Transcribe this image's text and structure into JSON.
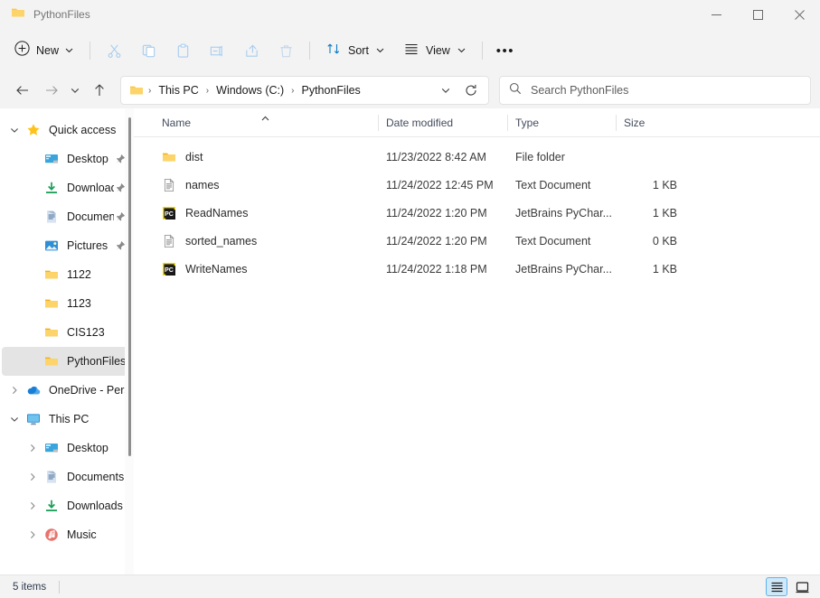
{
  "window": {
    "title": "PythonFiles",
    "title_icon": "folder-icon",
    "controls": {
      "minimize": "Minimize",
      "maximize": "Maximize",
      "close": "Close"
    }
  },
  "toolbar": {
    "new_label": "New",
    "new_icon": "plus-circle-icon",
    "chevron_icon": "chevron-down-icon",
    "actions": [
      {
        "name": "cut",
        "icon": "scissors-icon",
        "label": "Cut",
        "disabled": true
      },
      {
        "name": "copy",
        "icon": "copy-icon",
        "label": "Copy",
        "disabled": true
      },
      {
        "name": "paste",
        "icon": "clipboard-icon",
        "label": "Paste",
        "disabled": true
      },
      {
        "name": "rename",
        "icon": "rename-icon",
        "label": "Rename",
        "disabled": true
      },
      {
        "name": "share",
        "icon": "share-icon",
        "label": "Share",
        "disabled": true
      },
      {
        "name": "delete",
        "icon": "trash-icon",
        "label": "Delete",
        "disabled": true
      }
    ],
    "sort_label": "Sort",
    "sort_icon": "sort-arrows-icon",
    "view_label": "View",
    "view_icon": "list-lines-icon",
    "more_label": "•••"
  },
  "navigation": {
    "back_icon": "arrow-left-icon",
    "forward_icon": "arrow-right-icon",
    "recent_icon": "chevron-down-icon",
    "up_icon": "arrow-up-icon",
    "breadcrumb_icon": "folder-icon",
    "breadcrumbs": [
      "This PC",
      "Windows (C:)",
      "PythonFiles"
    ],
    "separator": "›",
    "dropdown_icon": "chevron-down-icon",
    "refresh_icon": "refresh-icon"
  },
  "search": {
    "icon": "search-icon",
    "placeholder": "Search PythonFiles",
    "value": ""
  },
  "sidebar": {
    "items": [
      {
        "label": "Quick access",
        "icon": "star-icon",
        "expanded": true,
        "chevron": "chevron-down-icon",
        "indent": 0,
        "pinned": false,
        "selected": false
      },
      {
        "label": "Desktop",
        "icon": "desktop-icon",
        "chevron": "",
        "indent": 1,
        "pinned": true,
        "selected": false
      },
      {
        "label": "Downloads",
        "icon": "downloads-icon",
        "chevron": "",
        "indent": 1,
        "pinned": true,
        "selected": false
      },
      {
        "label": "Documents",
        "icon": "documents-icon",
        "chevron": "",
        "indent": 1,
        "pinned": true,
        "selected": false
      },
      {
        "label": "Pictures",
        "icon": "pictures-icon",
        "chevron": "",
        "indent": 1,
        "pinned": true,
        "selected": false
      },
      {
        "label": "1122",
        "icon": "folder-icon",
        "chevron": "",
        "indent": 1,
        "pinned": false,
        "selected": false
      },
      {
        "label": "1123",
        "icon": "folder-icon",
        "chevron": "",
        "indent": 1,
        "pinned": false,
        "selected": false
      },
      {
        "label": "CIS123",
        "icon": "folder-icon",
        "chevron": "",
        "indent": 1,
        "pinned": false,
        "selected": false
      },
      {
        "label": "PythonFiles",
        "icon": "folder-icon",
        "chevron": "",
        "indent": 1,
        "pinned": false,
        "selected": true
      },
      {
        "label": "OneDrive - Perso",
        "icon": "onedrive-cloud-icon",
        "chevron": "chevron-right-icon",
        "indent": 0,
        "pinned": false,
        "selected": false
      },
      {
        "label": "This PC",
        "icon": "this-pc-icon",
        "expanded": true,
        "chevron": "chevron-down-icon",
        "indent": 0,
        "pinned": false,
        "selected": false
      },
      {
        "label": "Desktop",
        "icon": "desktop-icon",
        "chevron": "chevron-right-icon",
        "indent": 1,
        "pinned": false,
        "selected": false
      },
      {
        "label": "Documents",
        "icon": "documents-icon",
        "chevron": "chevron-right-icon",
        "indent": 1,
        "pinned": false,
        "selected": false
      },
      {
        "label": "Downloads",
        "icon": "downloads-icon",
        "chevron": "chevron-right-icon",
        "indent": 1,
        "pinned": false,
        "selected": false
      },
      {
        "label": "Music",
        "icon": "music-icon",
        "chevron": "chevron-right-icon",
        "indent": 1,
        "pinned": false,
        "selected": false
      }
    ]
  },
  "filelist": {
    "columns": [
      {
        "label": "Name",
        "sorted": "asc"
      },
      {
        "label": "Date modified",
        "sorted": ""
      },
      {
        "label": "Type",
        "sorted": ""
      },
      {
        "label": "Size",
        "sorted": ""
      }
    ],
    "sort_caret_icon": "caret-up-icon",
    "rows": [
      {
        "name": "dist",
        "icon": "folder-icon",
        "date": "11/23/2022 8:42 AM",
        "type": "File folder",
        "size": ""
      },
      {
        "name": "names",
        "icon": "text-file-icon",
        "date": "11/24/2022 12:45 PM",
        "type": "Text Document",
        "size": "1 KB"
      },
      {
        "name": "ReadNames",
        "icon": "pycharm-icon",
        "date": "11/24/2022 1:20 PM",
        "type": "JetBrains PyChar...",
        "size": "1 KB"
      },
      {
        "name": "sorted_names",
        "icon": "text-file-icon",
        "date": "11/24/2022 1:20 PM",
        "type": "Text Document",
        "size": "0 KB"
      },
      {
        "name": "WriteNames",
        "icon": "pycharm-icon",
        "date": "11/24/2022 1:18 PM",
        "type": "JetBrains PyChar...",
        "size": "1 KB"
      }
    ]
  },
  "statusbar": {
    "item_count": "5 items",
    "views": [
      {
        "name": "details-view",
        "icon": "details-view-icon",
        "active": true
      },
      {
        "name": "large-icons-view",
        "icon": "large-icons-view-icon",
        "active": false
      }
    ]
  },
  "colors": {
    "folder_yellow": "#fcc844",
    "accent_blue": "#5cb4ec",
    "selection_grey": "#e4e4e4",
    "chrome_grey": "#f3f3f3"
  }
}
